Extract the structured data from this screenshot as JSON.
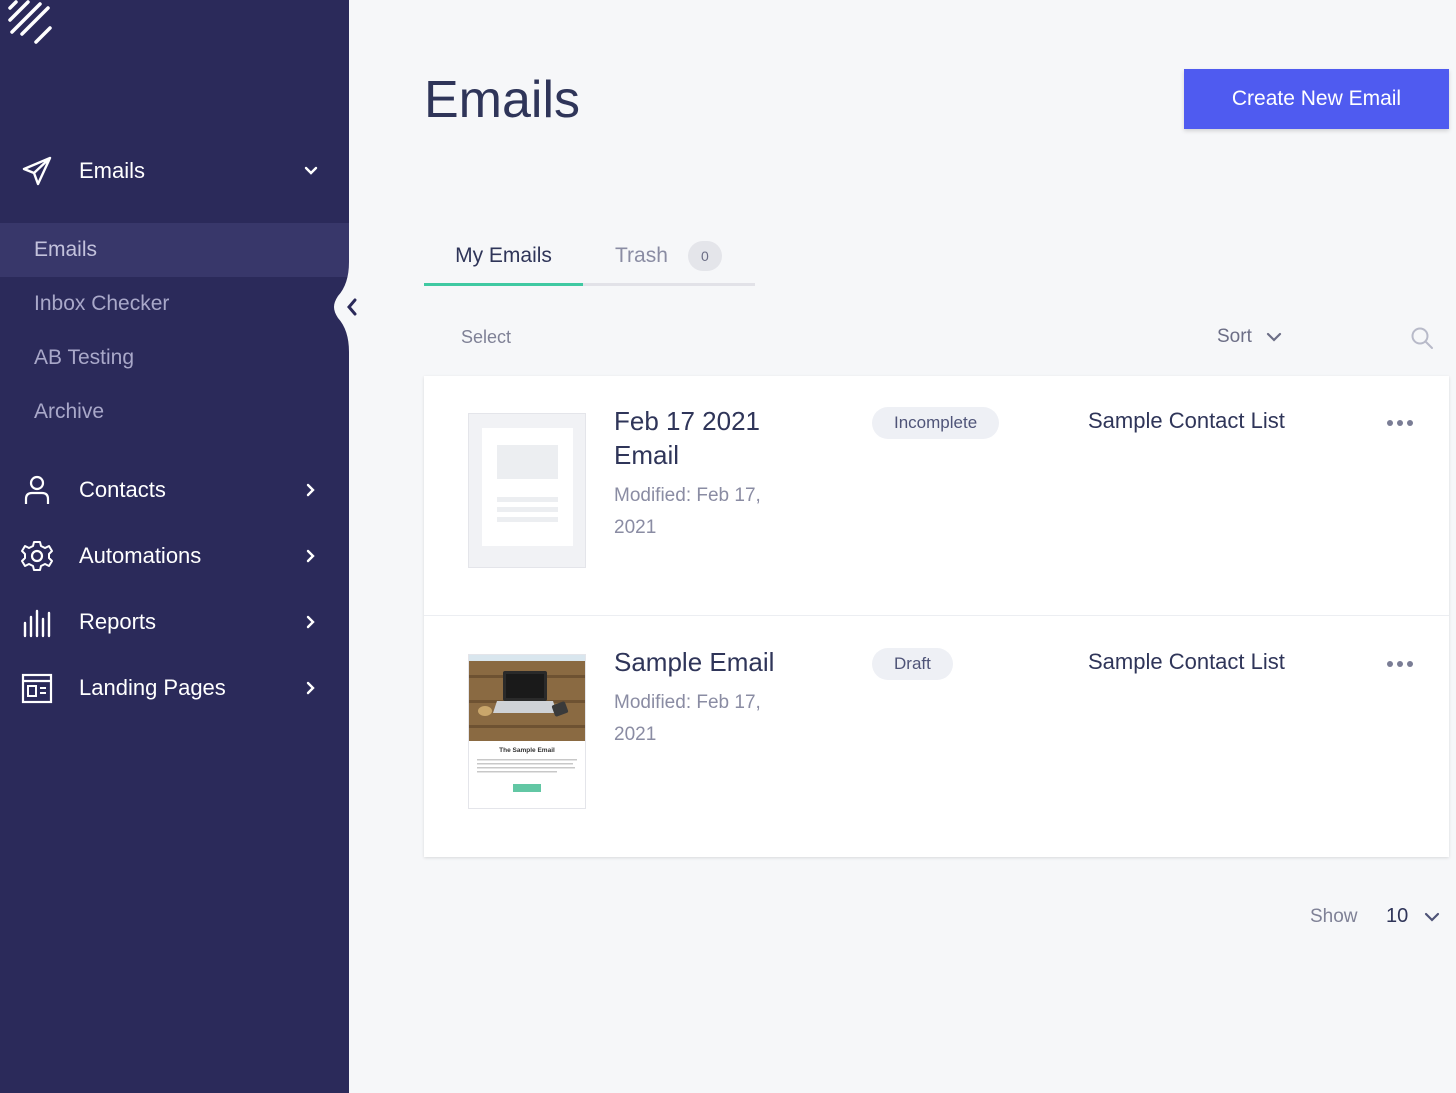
{
  "sidebar": {
    "emails_section": {
      "label": "Emails",
      "icon": "paper-plane-icon"
    },
    "sub_items": [
      {
        "label": "Emails",
        "active": true
      },
      {
        "label": "Inbox Checker",
        "active": false
      },
      {
        "label": "AB Testing",
        "active": false
      },
      {
        "label": "Archive",
        "active": false
      }
    ],
    "nav_items": [
      {
        "label": "Contacts",
        "icon": "user-icon"
      },
      {
        "label": "Automations",
        "icon": "gear-icon"
      },
      {
        "label": "Reports",
        "icon": "bar-chart-icon"
      },
      {
        "label": "Landing Pages",
        "icon": "landing-page-icon"
      }
    ]
  },
  "header": {
    "title": "Emails",
    "create_button": "Create New Email"
  },
  "tabs": {
    "my_emails": "My Emails",
    "trash": "Trash",
    "trash_count": "0"
  },
  "toolbar": {
    "select": "Select",
    "sort": "Sort"
  },
  "emails": [
    {
      "title": "Feb 17 2021 Email",
      "modified": "Modified: Feb 17, 2021",
      "status": "Incomplete",
      "list": "Sample Contact List"
    },
    {
      "title": "Sample Email",
      "modified": "Modified: Feb 17, 2021",
      "status": "Draft",
      "list": "Sample Contact List",
      "thumb_heading": "The Sample Email"
    }
  ],
  "pagination": {
    "show_label": "Show",
    "page_size": "10"
  },
  "colors": {
    "sidebar": "#2b2a5a",
    "accent": "#4f5bf0",
    "tab_active": "#40c9a2"
  }
}
